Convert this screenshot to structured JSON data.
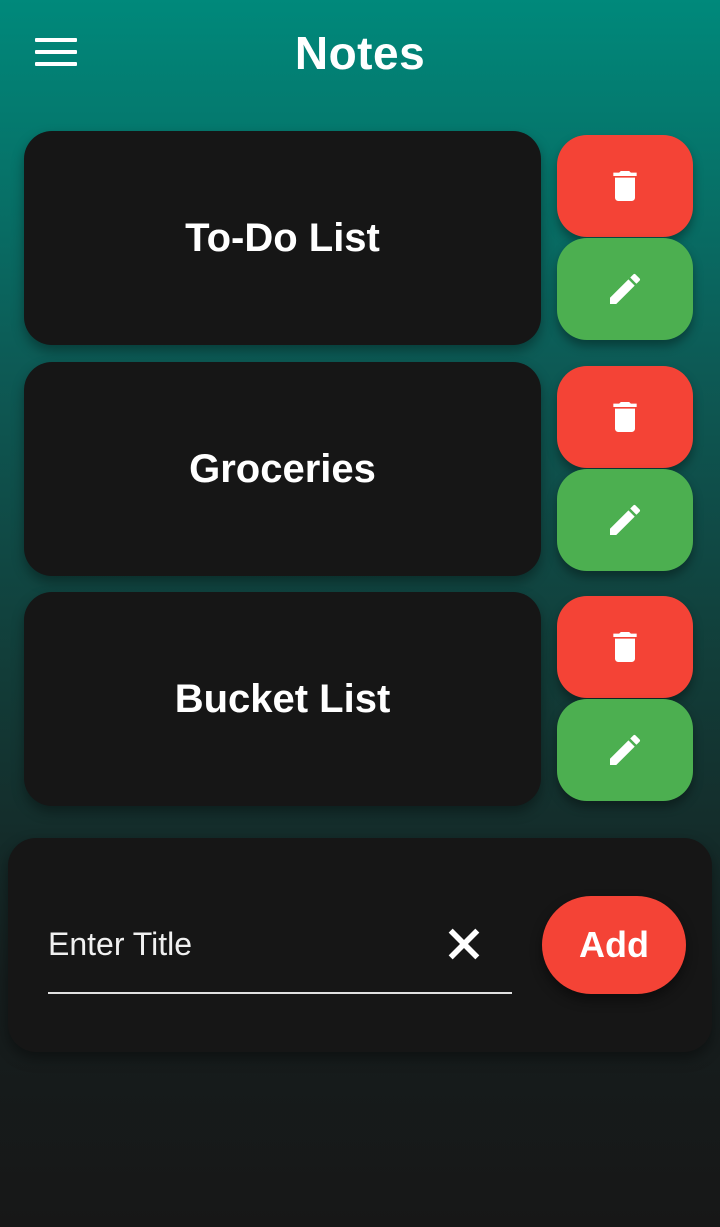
{
  "app_bar": {
    "title": "Notes",
    "menu_icon": "hamburger-menu-icon"
  },
  "notes": [
    {
      "title": "To-Do List",
      "delete_icon": "trash-icon",
      "edit_icon": "pencil-icon"
    },
    {
      "title": "Groceries",
      "delete_icon": "trash-icon",
      "edit_icon": "pencil-icon"
    },
    {
      "title": "Bucket List",
      "delete_icon": "trash-icon",
      "edit_icon": "pencil-icon"
    }
  ],
  "add_form": {
    "placeholder": "Enter Title",
    "value": "",
    "clear_icon": "close-icon",
    "add_label": "Add"
  },
  "colors": {
    "header_teal": "#00897b",
    "card": "#161616",
    "delete": "#f44336",
    "edit": "#4caf50",
    "add": "#f44336"
  }
}
